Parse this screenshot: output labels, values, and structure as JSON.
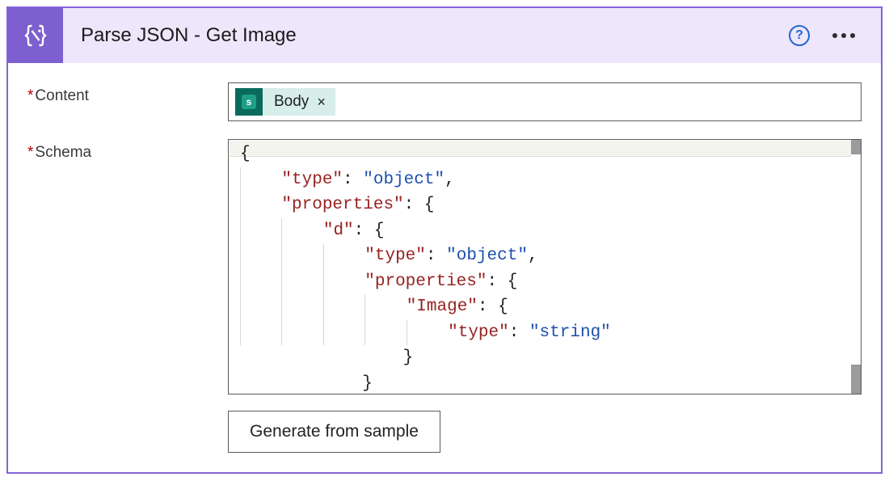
{
  "header": {
    "title": "Parse JSON - Get Image",
    "help_aria": "Help",
    "more_aria": "More options"
  },
  "fields": {
    "content_label": "Content",
    "schema_label": "Schema"
  },
  "content": {
    "token_source_icon_letter": "s",
    "token_label": "Body",
    "token_remove": "×"
  },
  "schema": {
    "lines": [
      {
        "raw": "{",
        "segments": [
          {
            "t": "{",
            "c": "pun"
          }
        ]
      },
      {
        "raw": "    \"type\": \"object\",",
        "segments": [
          {
            "t": "    ",
            "c": ""
          },
          {
            "t": "\"type\"",
            "c": "kw"
          },
          {
            "t": ": ",
            "c": "pun"
          },
          {
            "t": "\"object\"",
            "c": "str"
          },
          {
            "t": ",",
            "c": "pun"
          }
        ]
      },
      {
        "raw": "    \"properties\": {",
        "segments": [
          {
            "t": "    ",
            "c": ""
          },
          {
            "t": "\"properties\"",
            "c": "kw"
          },
          {
            "t": ": {",
            "c": "pun"
          }
        ]
      },
      {
        "raw": "        \"d\": {",
        "segments": [
          {
            "t": "        ",
            "c": ""
          },
          {
            "t": "\"d\"",
            "c": "kw"
          },
          {
            "t": ": {",
            "c": "pun"
          }
        ]
      },
      {
        "raw": "            \"type\": \"object\",",
        "segments": [
          {
            "t": "            ",
            "c": ""
          },
          {
            "t": "\"type\"",
            "c": "kw"
          },
          {
            "t": ": ",
            "c": "pun"
          },
          {
            "t": "\"object\"",
            "c": "str"
          },
          {
            "t": ",",
            "c": "pun"
          }
        ]
      },
      {
        "raw": "            \"properties\": {",
        "segments": [
          {
            "t": "            ",
            "c": ""
          },
          {
            "t": "\"properties\"",
            "c": "kw"
          },
          {
            "t": ": {",
            "c": "pun"
          }
        ]
      },
      {
        "raw": "                \"Image\": {",
        "segments": [
          {
            "t": "                ",
            "c": ""
          },
          {
            "t": "\"Image\"",
            "c": "kw"
          },
          {
            "t": ": {",
            "c": "pun"
          }
        ]
      },
      {
        "raw": "                    \"type\": \"string\"",
        "segments": [
          {
            "t": "                    ",
            "c": ""
          },
          {
            "t": "\"type\"",
            "c": "kw"
          },
          {
            "t": ": ",
            "c": "pun"
          },
          {
            "t": "\"string\"",
            "c": "str"
          }
        ]
      },
      {
        "raw": "                }",
        "segments": [
          {
            "t": "                }",
            "c": "pun"
          }
        ]
      },
      {
        "raw": "            }",
        "segments": [
          {
            "t": "            }",
            "c": "pun"
          }
        ]
      }
    ]
  },
  "buttons": {
    "generate_from_sample": "Generate from sample"
  }
}
